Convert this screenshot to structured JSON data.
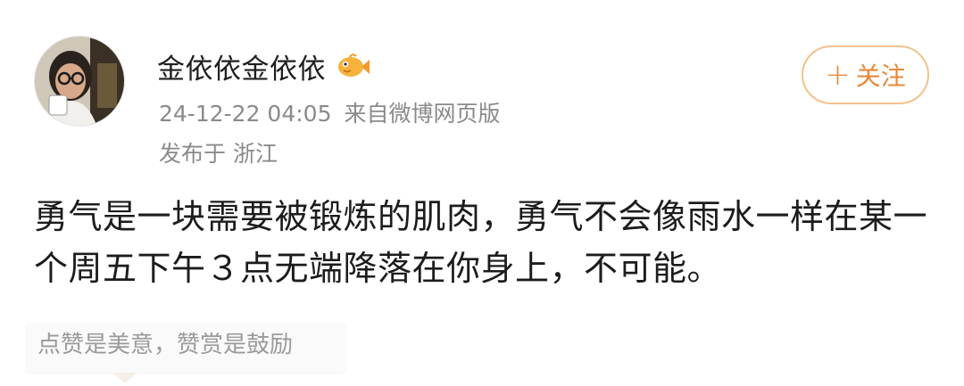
{
  "post": {
    "author": {
      "name": "金依依金依依",
      "badge_icon": "fish-badge-icon",
      "avatar_icon": "user-avatar"
    },
    "meta": {
      "timestamp": "24-12-22 04:05",
      "source": "来自微博网页版",
      "location": "发布于 浙江"
    },
    "follow_button": {
      "plus": "+",
      "label": "关注"
    },
    "content": "勇气是一块需要被锻炼的肌肉，勇气不会像雨水一样在某一个周五下午３点无端降落在你身上，不可能。",
    "reward_hint": "点赞是美意，赞赏是鼓励"
  },
  "colors": {
    "accent": "#e8893a",
    "follow_border": "#f2c28a",
    "meta_text": "#8a8a8a"
  }
}
